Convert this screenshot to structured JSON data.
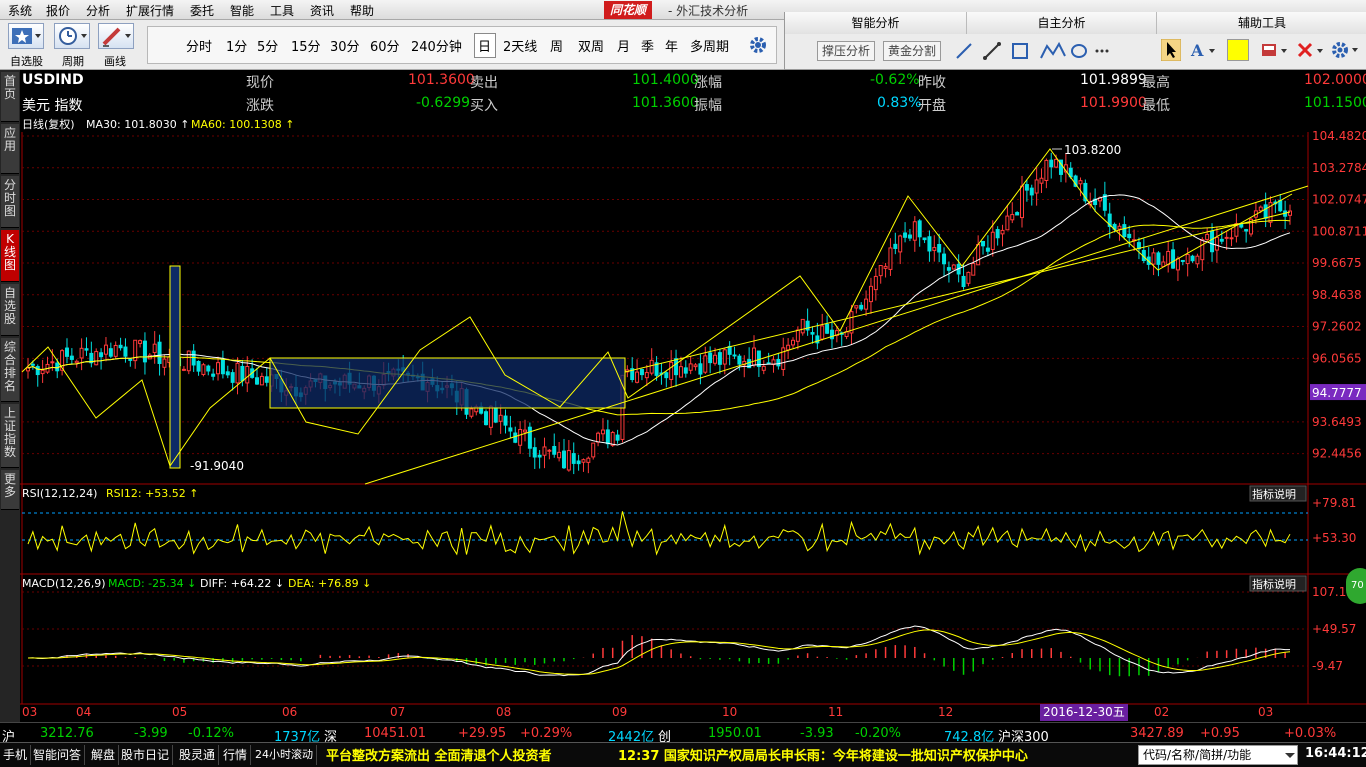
{
  "menu": [
    "系统",
    "报价",
    "分析",
    "扩展行情",
    "委托",
    "智能",
    "工具",
    "资讯",
    "帮助"
  ],
  "brand": "同花顺",
  "brand_title": "- 外汇技术分析",
  "window_controls": [
    "_",
    "□",
    "X"
  ],
  "toolbar": {
    "btn1": "自选股",
    "btn2": "周期",
    "btn3": "画线",
    "periods": [
      "分时",
      "1分",
      "5分",
      "15分",
      "30分",
      "60分",
      "240分钟",
      "日",
      "2天线",
      "周",
      "双周",
      "月",
      "季",
      "年",
      "多周期"
    ],
    "selected_period": "日"
  },
  "right_panel": {
    "tabs": [
      "智能分析",
      "自主分析",
      "辅助工具"
    ],
    "btn_support": "撑压分析",
    "btn_gold": "黄金分割",
    "draw_icons": [
      "line-icon",
      "ray-icon",
      "rect-icon",
      "wave-icon",
      "circle-icon",
      "more-icon",
      "cursor-icon",
      "text-icon",
      "color-icon",
      "erase-icon",
      "delete-icon",
      "settings-icon"
    ]
  },
  "left_nav": [
    "首页",
    "应用",
    "分时图",
    "K线图",
    "自选股",
    "综合排名",
    "上证指数",
    "更多"
  ],
  "info": {
    "symbol": "USDIND",
    "name": "美元 指数",
    "cells": [
      {
        "label": "现价",
        "value": "101.3600",
        "color": "#ff3a3a"
      },
      {
        "label": "卖出",
        "value": "101.4000",
        "color": "#00d000"
      },
      {
        "label": "涨幅",
        "value": "-0.62%",
        "color": "#00d000"
      },
      {
        "label": "昨收",
        "value": "101.9899",
        "color": "#ffffff"
      },
      {
        "label": "最高",
        "value": "102.0000",
        "color": "#ff3a3a"
      },
      {
        "label": "涨跌",
        "value": "-0.6299",
        "color": "#00d000"
      },
      {
        "label": "买入",
        "value": "101.3600",
        "color": "#00d000"
      },
      {
        "label": "振幅",
        "value": "0.83%",
        "color": "#00d8ff"
      },
      {
        "label": "开盘",
        "value": "101.9900",
        "color": "#ff3a3a"
      },
      {
        "label": "最低",
        "value": "101.1500",
        "color": "#00d000"
      }
    ]
  },
  "main_legend": {
    "mode": "日线(复权)",
    "ma30": "MA30: 101.8030",
    "ma60": "MA60: 100.1308"
  },
  "price_axis": [
    "104.4820",
    "103.2784",
    "102.0747",
    "100.8711",
    "99.6675",
    "98.4638",
    "97.2602",
    "96.0565",
    "93.6493",
    "92.4456"
  ],
  "current_price_tag": "94.7777",
  "annotations": {
    "high": "103.8200",
    "low": "91.9040"
  },
  "rsi": {
    "title": "RSI(12,12,24)",
    "value": "RSI12: +53.52",
    "axis": [
      "+79.81",
      "+53.30"
    ],
    "explain": "指标说明"
  },
  "macd": {
    "title": "MACD(12,26,9)",
    "macd": "MACD: -25.34",
    "diff": "DIFF: +64.22",
    "dea": "DEA: +76.89",
    "axis": [
      "107.1",
      "+49.57",
      "-9.47"
    ],
    "explain": "指标说明"
  },
  "x_axis": [
    "03",
    "04",
    "05",
    "06",
    "07",
    "08",
    "09",
    "10",
    "11",
    "12",
    "01",
    "02",
    "03"
  ],
  "date_chip": "2016-12-30五",
  "status": {
    "sh_label": "沪",
    "sh_index": "3212.76",
    "sh_chg": "-3.99",
    "sh_pct": "-0.12%",
    "sh_amt": "1737亿",
    "sz_label": "深",
    "sz_index": "10451.01",
    "sz_chg": "+29.95",
    "sz_pct": "+0.29%",
    "sz_amt": "2442亿",
    "cy_label": "创",
    "cy_index": "1950.01",
    "cy_chg": "-3.93",
    "cy_pct": "-0.20%",
    "cy_amt": "742.8亿",
    "hs_label": "沪深300",
    "hs_index": "3427.89",
    "hs_chg": "+0.95",
    "hs_pct": "+0.03%"
  },
  "bottom": {
    "items": [
      "手机",
      "智能问答",
      "解盘",
      "股市日记",
      "股灵通",
      "行情",
      "24小时滚动"
    ],
    "ticker": "平台整改方案流出 全面清退个人投资者",
    "news": "12:37 国家知识产权局局长申长雨：今年将建设一批知识产权保护中心",
    "search_placeholder": "代码/名称/简拼/功能",
    "clock": "16:44:12"
  },
  "badge": "70"
}
